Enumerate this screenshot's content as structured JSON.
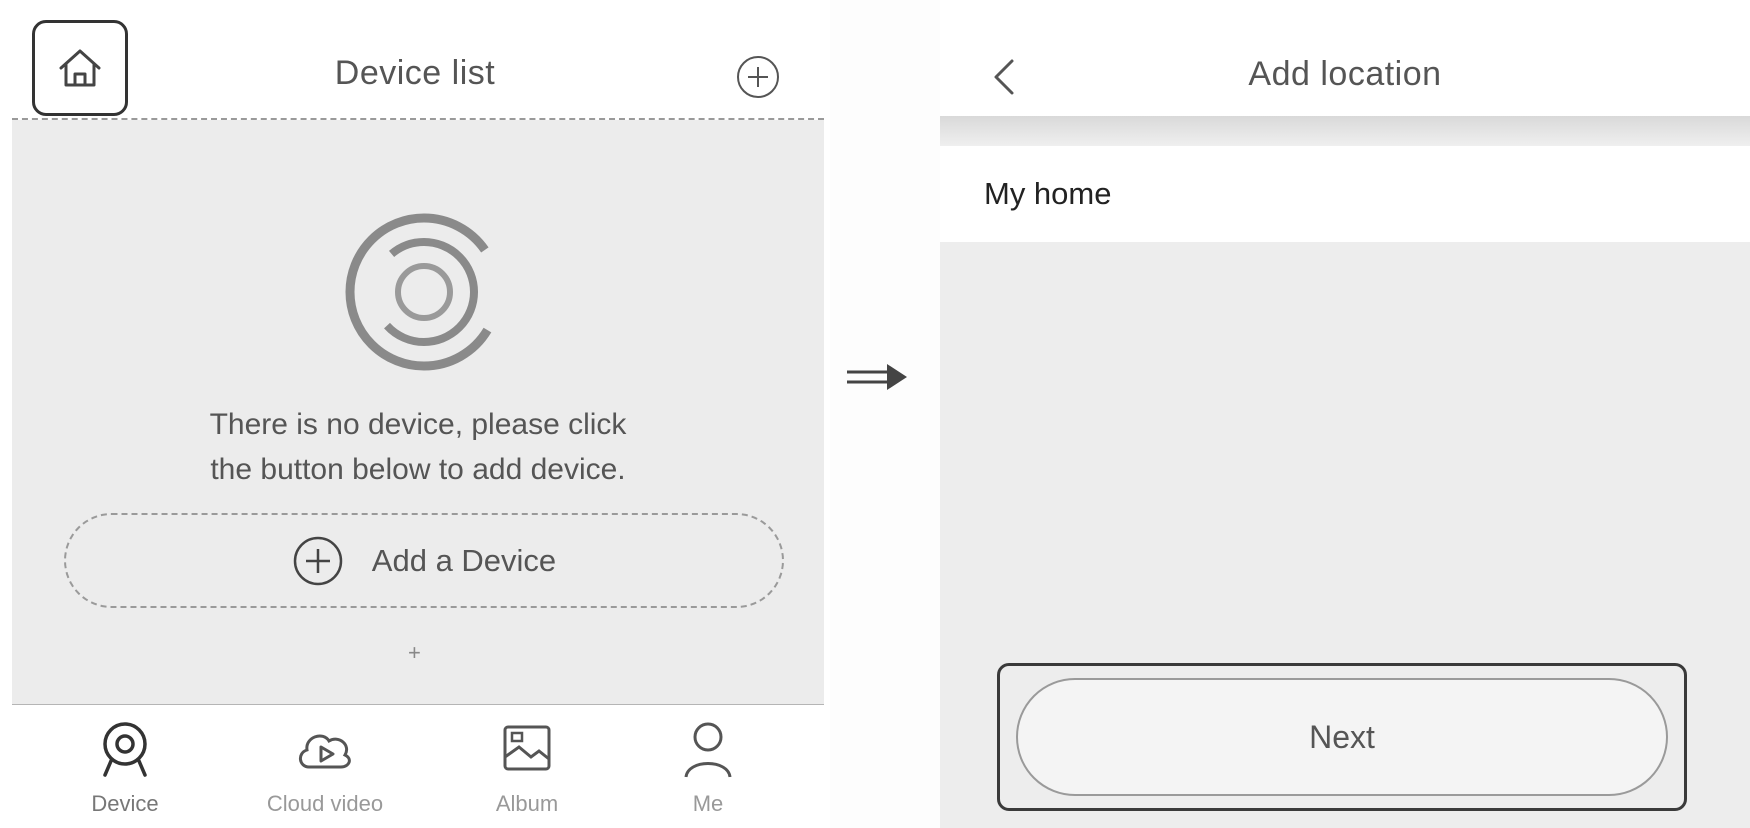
{
  "left_screen": {
    "header": {
      "title": "Device list",
      "home_icon": "home-icon",
      "add_icon": "plus-circle-icon"
    },
    "empty_state": {
      "graphic_icon": "empty-spinner-icon",
      "message_line1": "There is no device, please click",
      "message_line2": "the button below to add device.",
      "add_device_label": "Add a Device",
      "hint_symbol": "+"
    },
    "tabbar": {
      "items": [
        {
          "label": "Device",
          "icon": "camera-icon",
          "active": true
        },
        {
          "label": "Cloud video",
          "icon": "cloud-play-icon",
          "active": false
        },
        {
          "label": "Album",
          "icon": "album-icon",
          "active": false
        },
        {
          "label": "Me",
          "icon": "person-icon",
          "active": false
        }
      ]
    }
  },
  "flow_arrow": "arrow-right-icon",
  "right_screen": {
    "header": {
      "title": "Add location",
      "back_icon": "chevron-left-icon"
    },
    "location_name": "My home",
    "next_label": "Next"
  },
  "colors": {
    "background": "#ececec",
    "text": "#555555",
    "highlight_border": "#333333"
  }
}
